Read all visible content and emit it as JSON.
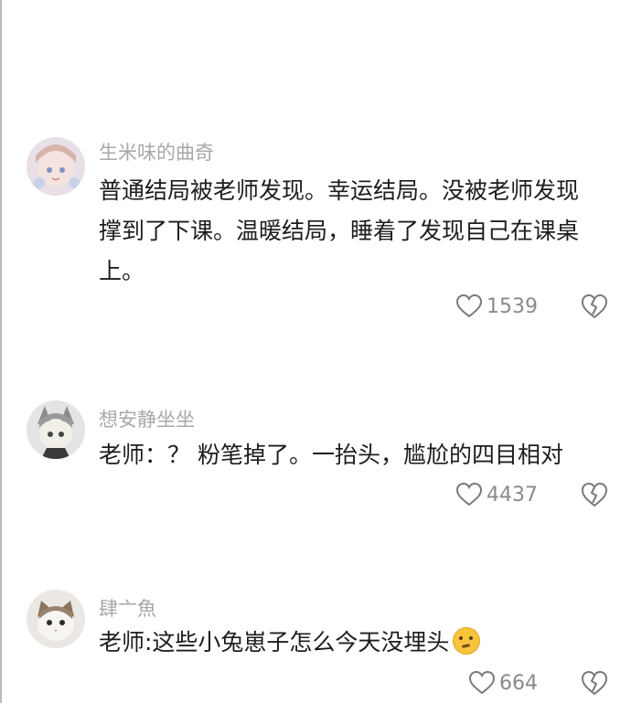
{
  "comments": [
    {
      "username": "生米味的曲奇",
      "lines": [
        "普通结局被老师发现。幸运结局。没被老师发现",
        "撑到了下课。温暖结局，睡着了发现自己在课桌",
        "上。"
      ],
      "likes": "1539"
    },
    {
      "username": "想安静坐坐",
      "lines": [
        "老师：？ 粉笔掉了。一抬头，尴尬的四目相对"
      ],
      "likes": "4437"
    },
    {
      "username": "肆亠魚",
      "lines": [
        "老师:这些小兔崽子怎么今天没埋头"
      ],
      "likes": "664",
      "emoji": "thinking-face-emoji"
    }
  ],
  "icons": {
    "like": "heart-outline-icon",
    "dislike": "broken-heart-icon"
  },
  "colors": {
    "username": "#a8a8a8",
    "text": "#1d1d1d",
    "count": "#8a8a8a",
    "icon": "#7a7a7a"
  }
}
